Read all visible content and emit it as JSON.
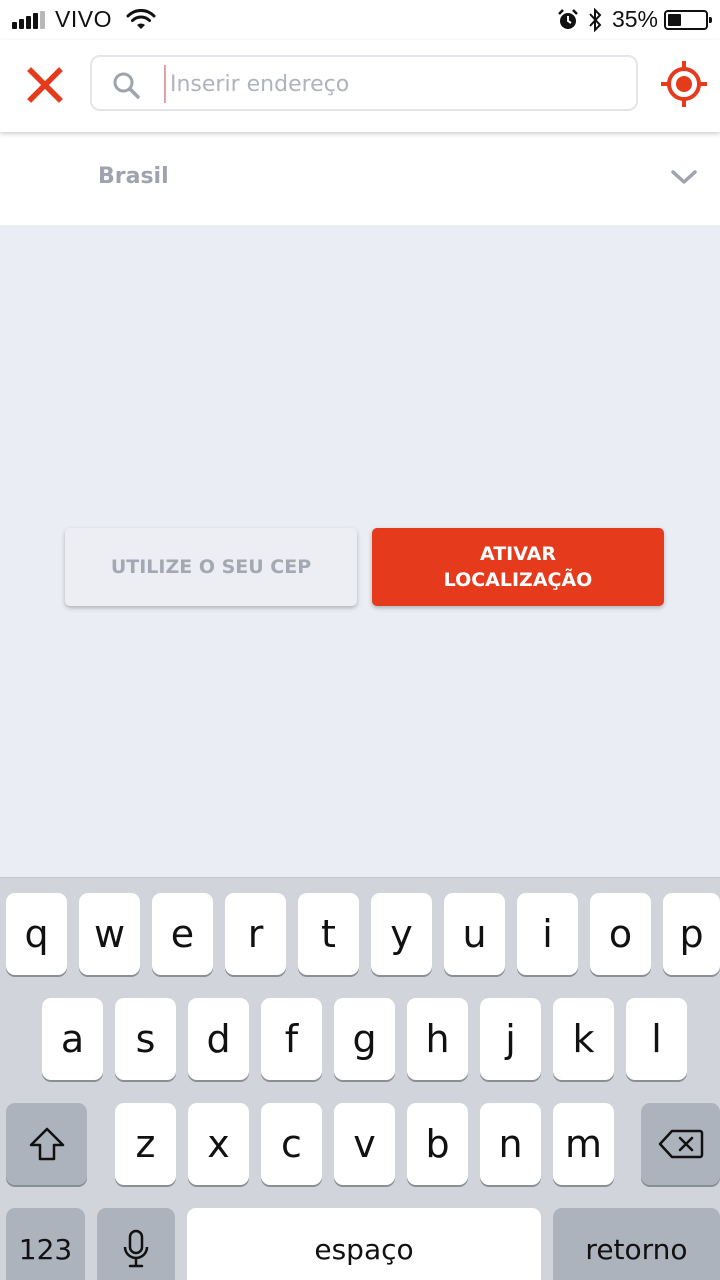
{
  "status_bar": {
    "carrier": "VIVO",
    "battery_percent_text": "35%",
    "battery_level": 0.35,
    "icons": [
      "signal-icon",
      "wifi-icon",
      "alarm-icon",
      "bluetooth-icon",
      "battery-icon"
    ]
  },
  "header": {
    "close_icon": "close-icon",
    "search": {
      "placeholder": "Inserir endereço",
      "value": "",
      "icon": "search-icon"
    },
    "locate_icon": "crosshair-icon"
  },
  "country_selector": {
    "label": "Brasil",
    "icon": "chevron-down-icon"
  },
  "actions": {
    "cep_button": "UTILIZE O SEU CEP",
    "location_button_line1": "ATIVAR",
    "location_button_line2": "LOCALIZAÇÃO"
  },
  "keyboard": {
    "row1": [
      "q",
      "w",
      "e",
      "r",
      "t",
      "y",
      "u",
      "i",
      "o",
      "p"
    ],
    "row2": [
      "a",
      "s",
      "d",
      "f",
      "g",
      "h",
      "j",
      "k",
      "l"
    ],
    "row3": [
      "z",
      "x",
      "c",
      "v",
      "b",
      "n",
      "m"
    ],
    "numbers_key": "123",
    "space_key": "espaço",
    "return_key": "retorno",
    "shift_icon": "shift-icon",
    "delete_icon": "delete-icon",
    "mic_icon": "microphone-icon"
  },
  "colors": {
    "accent": "#e63a1c",
    "background": "#eaedf3"
  }
}
